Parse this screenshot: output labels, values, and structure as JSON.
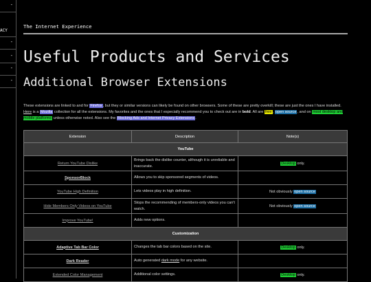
{
  "sidebar": {
    "items": [
      {
        "label": "",
        "marker": "-"
      },
      {
        "label": "ACY",
        "marker": ""
      },
      {
        "label": "",
        "marker": "-"
      },
      {
        "label": "",
        "marker": "-"
      },
      {
        "label": "",
        "marker": "-"
      },
      {
        "label": "",
        "marker": "-"
      }
    ]
  },
  "header": {
    "site_title": "The Internet Experience"
  },
  "page": {
    "title": "Useful Products and Services",
    "subtitle": "Additional Browser Extensions"
  },
  "intro": {
    "p1": "These extensions are linked to and for ",
    "firefox": "Firefox",
    "p2": ", but they or similar versions can likely be found on other browsers. Some of these are pretty overkill; these are just the ones I have installed.",
    "here": "Here",
    "p3": " is a ",
    "mozilla": "Mozilla",
    "p4": " collection for all the extensions. My favorites and the ones that I especially recommend you to check out are in ",
    "bold": "bold",
    "p5": ". All are ",
    "free": "free",
    "p6": ", ",
    "open_source": "open source",
    "p7": ", and on ",
    "platforms": "most desktop and mobile platforms",
    "p8": " unless otherwise noted. Also see the ",
    "blocking": "Blocking Ads and Internet Privacy Extensions",
    "p9": "."
  },
  "table": {
    "headers": [
      "Extension",
      "Description",
      "Note(s)"
    ],
    "sections": {
      "youtube": "YouTube",
      "customization": "Customization"
    },
    "rows": [
      {
        "ext": "Return YouTube Dislike",
        "desc": "Brings back the dislike counter, although it is unreliable and inaccurate.",
        "note_tag": "Desktop",
        "note_rest": " only."
      },
      {
        "ext": "SponsorBlock",
        "desc": "Allows you to skip sponsored segments of videos."
      },
      {
        "ext": "YouTube High Definition",
        "desc": "Lets videos play in high definition.",
        "note_pre": "Not obviously ",
        "note_tag": "open source"
      },
      {
        "ext": "Hide Members Only Videos on YouTube",
        "desc": "Stops the recommending of members-only videos you can't watch.",
        "note_pre": "Not obviously ",
        "note_tag": "open source"
      },
      {
        "ext": "Improve YouTube!",
        "desc": "Adds new options."
      },
      {
        "ext": "Adaptive Tab Bar Color",
        "desc": "Changes the tab bar colors based on the site.",
        "note_tag": "Desktop",
        "note_rest": " only."
      },
      {
        "ext": "Dark Reader",
        "desc_pre": "Auto generated ",
        "desc_link": "dark mode",
        "desc_post": " for any website."
      },
      {
        "ext": "Extended Color Management",
        "desc": "Additional color settings.",
        "note_tag": "Desktop",
        "note_rest": " only."
      }
    ]
  }
}
